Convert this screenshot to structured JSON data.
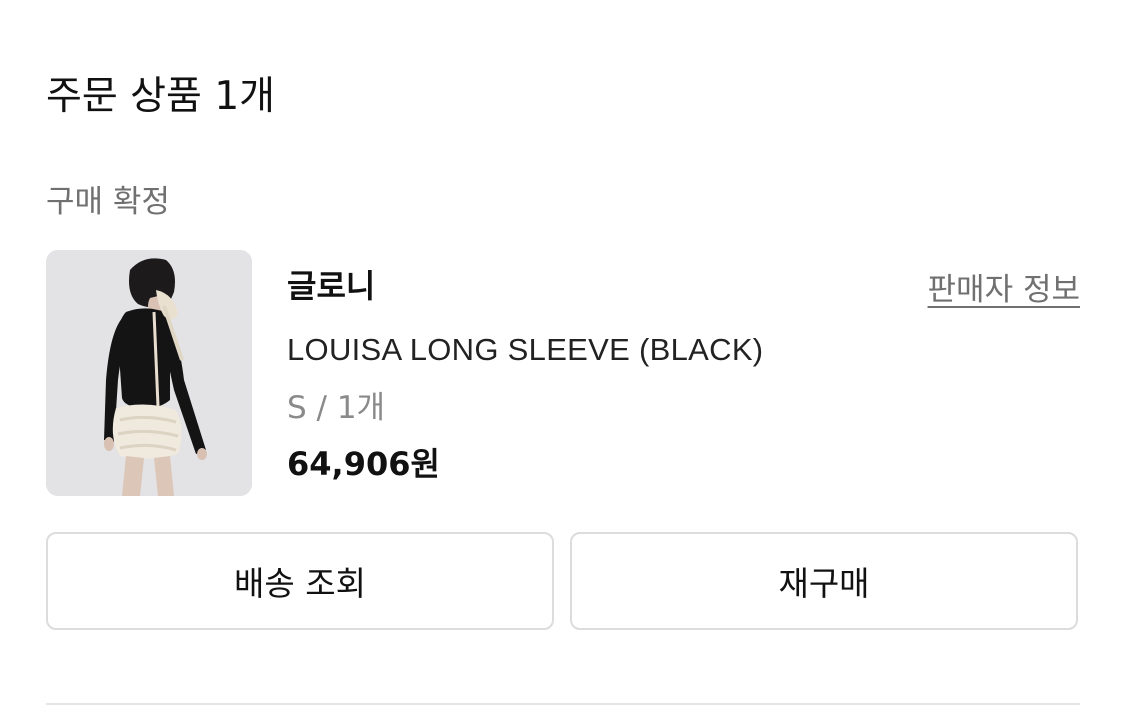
{
  "order": {
    "title": "주문 상품 1개",
    "status": "구매 확정"
  },
  "product": {
    "brand": "글로니",
    "seller_info_label": "판매자 정보",
    "name": "LOUISA LONG SLEEVE (BLACK)",
    "option": "S / 1개",
    "price": "64,906원",
    "image_icon": "product-photo"
  },
  "actions": {
    "track_delivery_label": "배송 조회",
    "reorder_label": "재구매"
  },
  "colors": {
    "text_primary": "#111111",
    "text_secondary": "#707070",
    "border": "#dcdcdc"
  }
}
